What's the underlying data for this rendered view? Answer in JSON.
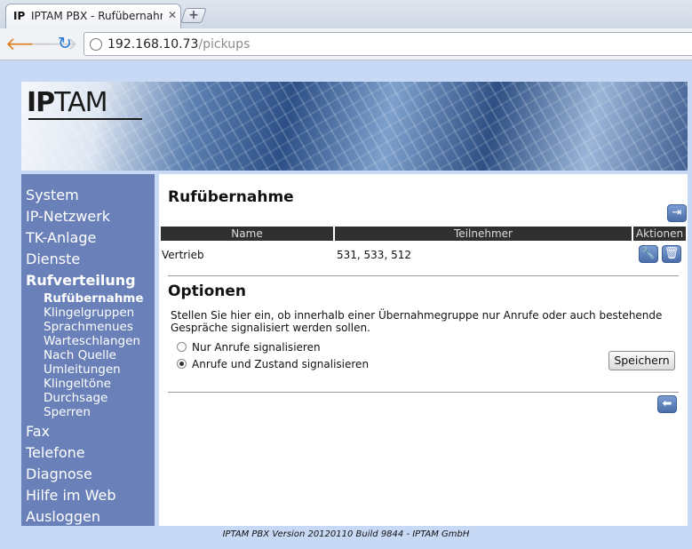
{
  "browser": {
    "tab_title": "IPTAM PBX - Rufübernahme",
    "favicon_text": "IP",
    "new_tab": "+",
    "url_host": "192.168.10.73",
    "url_path": "/pickups"
  },
  "brand": {
    "logo_bold": "IP",
    "logo_thin": "TAM"
  },
  "sidebar": {
    "items": [
      {
        "label": "System"
      },
      {
        "label": "IP-Netzwerk"
      },
      {
        "label": "TK-Anlage"
      },
      {
        "label": "Dienste"
      },
      {
        "label": "Rufverteilung"
      }
    ],
    "subitems": [
      {
        "label": "Rufübernahme"
      },
      {
        "label": "Klingelgruppen"
      },
      {
        "label": "Sprachmenues"
      },
      {
        "label": "Warteschlangen"
      },
      {
        "label": "Nach Quelle"
      },
      {
        "label": "Umleitungen"
      },
      {
        "label": "Klingeltöne"
      },
      {
        "label": "Durchsage"
      },
      {
        "label": "Sperren"
      }
    ],
    "items_after": [
      {
        "label": "Fax"
      },
      {
        "label": "Telefone"
      },
      {
        "label": "Diagnose"
      },
      {
        "label": "Hilfe im Web"
      },
      {
        "label": "Ausloggen"
      }
    ]
  },
  "main": {
    "title": "Rufübernahme",
    "table": {
      "headers": {
        "name": "Name",
        "teilnehmer": "Teilnehmer",
        "aktionen": "Aktionen"
      },
      "rows": [
        {
          "name": "Vertrieb",
          "teilnehmer": "531, 533, 512"
        }
      ]
    },
    "options": {
      "title": "Optionen",
      "description": "Stellen Sie hier ein, ob innerhalb einer Übernahmegruppe nur Anrufe oder auch bestehende Gespräche signalisiert werden sollen.",
      "radio1": "Nur Anrufe signalisieren",
      "radio2": "Anrufe und Zustand signalisieren",
      "save": "Speichern"
    }
  },
  "footer": "IPTAM PBX Version 20120110 Build 9844 - IPTAM GmbH",
  "colors": {
    "sidebar": "#6a80b8",
    "header_row": "#303030",
    "button_blue": "#4a6ea8"
  }
}
